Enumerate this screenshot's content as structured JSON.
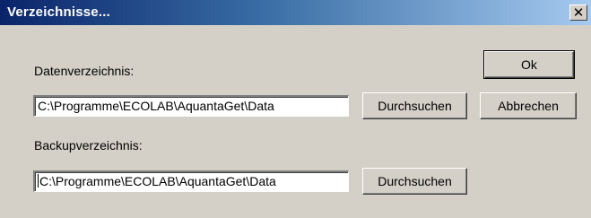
{
  "window": {
    "title": "Verzeichnisse...",
    "close_glyph": "✕"
  },
  "data_dir": {
    "label": "Datenverzeichnis:",
    "value": "C:\\Programme\\ECOLAB\\AquantaGet\\Data",
    "browse_label": "Durchsuchen"
  },
  "backup_dir": {
    "label": "Backupverzeichnis:",
    "value": "C:\\Programme\\ECOLAB\\AquantaGet\\Data",
    "browse_label": "Durchsuchen"
  },
  "buttons": {
    "ok_label": "Ok",
    "cancel_label": "Abbrechen"
  }
}
